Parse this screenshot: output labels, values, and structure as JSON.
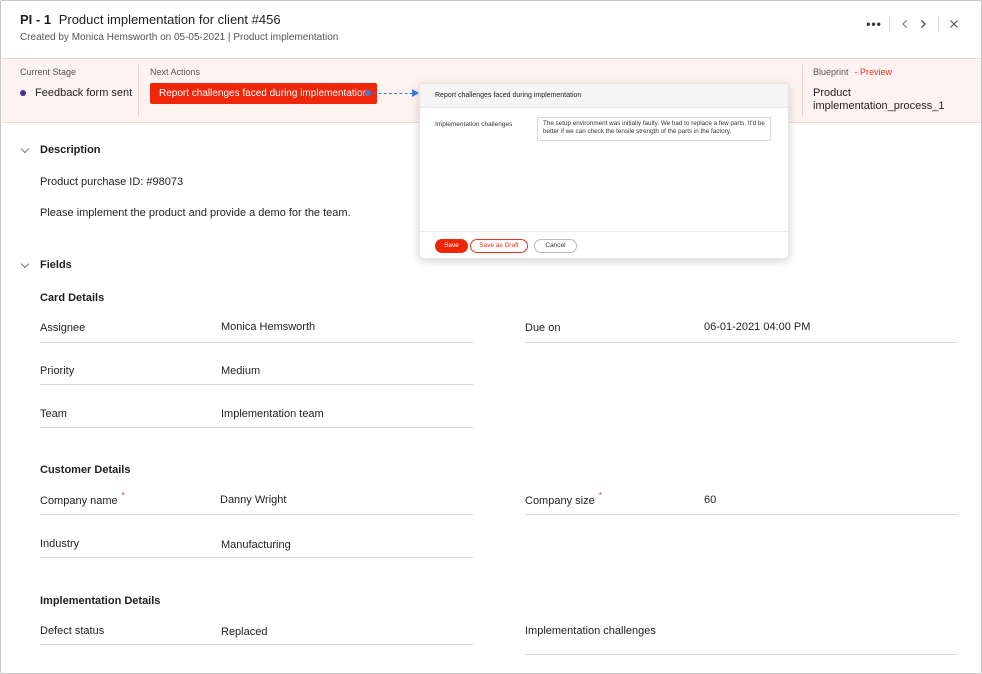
{
  "header": {
    "id": "PI - 1",
    "title": "Product implementation for client #456",
    "created_prefix": "Created by",
    "creator": "Monica Hemsworth",
    "created_on": "on 05-05-2021",
    "separator": "|",
    "category": "Product implementation",
    "icons": [
      "more-icon",
      "chevron-left-icon",
      "chevron-right-icon",
      "close-icon"
    ]
  },
  "stage_bar": {
    "current_stage_label": "Current Stage",
    "current_stage": "Feedback form sent",
    "next_actions_label": "Next Actions",
    "next_action": "Report challenges faced during implementation",
    "blueprint_label": "Blueprint",
    "blueprint_preview": "- Preview",
    "blueprint_name": "Product implementation_process_1",
    "colors": {
      "accent": "#f0260a",
      "stage_dot": "#4b2f8a",
      "connector": "#3a7bdc"
    }
  },
  "popup": {
    "title": "Report challenges faced during implementation",
    "field_label": "Implementation challenges",
    "field_value": "The setup environment was initially faulty. We had to replace a few parts. It'd be better if we can check the tensile strength of the parts in the factory.",
    "save": "Save",
    "save_draft": "Save as Draft",
    "cancel": "Cancel"
  },
  "description": {
    "heading": "Description",
    "line1": "Product purchase ID: #98073",
    "line2": "Please implement the product and provide a demo for the team."
  },
  "fields": {
    "heading": "Fields",
    "card_details": {
      "heading": "Card Details",
      "assignee_label": "Assignee",
      "assignee": "Monica Hemsworth",
      "due_label": "Due on",
      "due": "06-01-2021 04:00 PM",
      "priority_label": "Priority",
      "priority": "Medium",
      "team_label": "Team",
      "team": "Implementation team"
    },
    "customer_details": {
      "heading": "Customer Details",
      "company_label": "Company name",
      "company": "Danny Wright",
      "size_label": "Company size",
      "size": "60",
      "industry_label": "Industry",
      "industry": "Manufacturing",
      "required_mark": "*"
    },
    "implementation_details": {
      "heading": "Implementation Details",
      "defect_label": "Defect status",
      "defect": "Replaced",
      "challenges_label": "Implementation challenges"
    }
  }
}
